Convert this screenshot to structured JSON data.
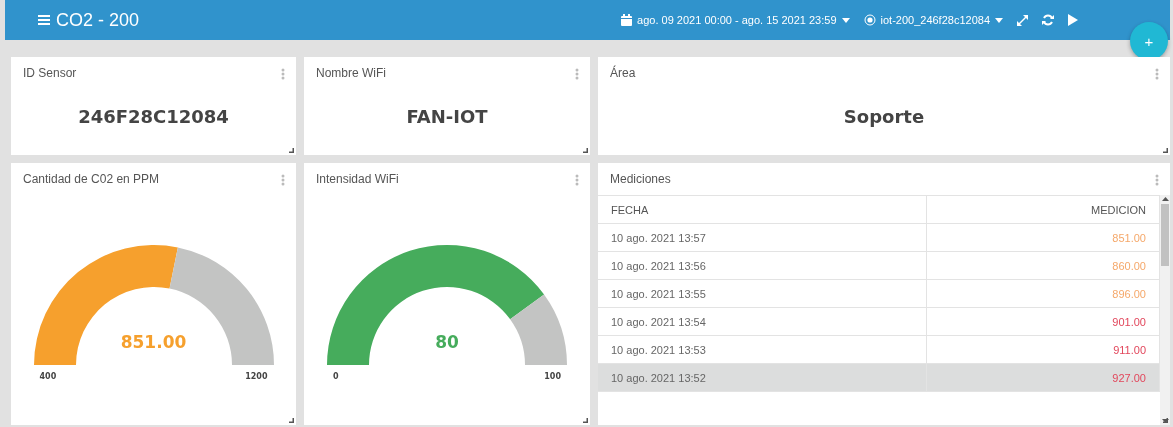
{
  "header": {
    "title": "CO2 - 200",
    "date_range": "ago. 09 2021 00:00 - ago. 15 2021 23:59",
    "device": "iot-200_246f28c12084"
  },
  "add_button": {
    "label": "+"
  },
  "widgets": [
    {
      "kind": "value",
      "title": "ID Sensor",
      "value": "246F28C12084"
    },
    {
      "kind": "value",
      "title": "Nombre WiFi",
      "value": "FAN-IOT"
    },
    {
      "kind": "value",
      "title": "Área",
      "value": "Soporte"
    },
    {
      "kind": "gauge",
      "title": "Cantidad de C02 en PPM",
      "value": "851.00",
      "min": "400",
      "max": "1200",
      "color": "#f6a02d"
    },
    {
      "kind": "gauge",
      "title": "Intensidad WiFi",
      "value": "80",
      "min": "0",
      "max": "100",
      "color": "#46ac5c"
    },
    {
      "kind": "table",
      "title": "Mediciones",
      "columns": [
        "FECHA",
        "MEDICION"
      ],
      "rows": [
        {
          "date": "10 ago. 2021 13:57",
          "value": "851.00",
          "color": "#f5a86a",
          "selected": false
        },
        {
          "date": "10 ago. 2021 13:56",
          "value": "860.00",
          "color": "#f5a86a",
          "selected": false
        },
        {
          "date": "10 ago. 2021 13:55",
          "value": "896.00",
          "color": "#f5a86a",
          "selected": false
        },
        {
          "date": "10 ago. 2021 13:54",
          "value": "901.00",
          "color": "#e2475c",
          "selected": false
        },
        {
          "date": "10 ago. 2021 13:53",
          "value": "911.00",
          "color": "#e2475c",
          "selected": false
        },
        {
          "date": "10 ago. 2021 13:52",
          "value": "927.00",
          "color": "#e2475c",
          "selected": true
        }
      ]
    }
  ]
}
